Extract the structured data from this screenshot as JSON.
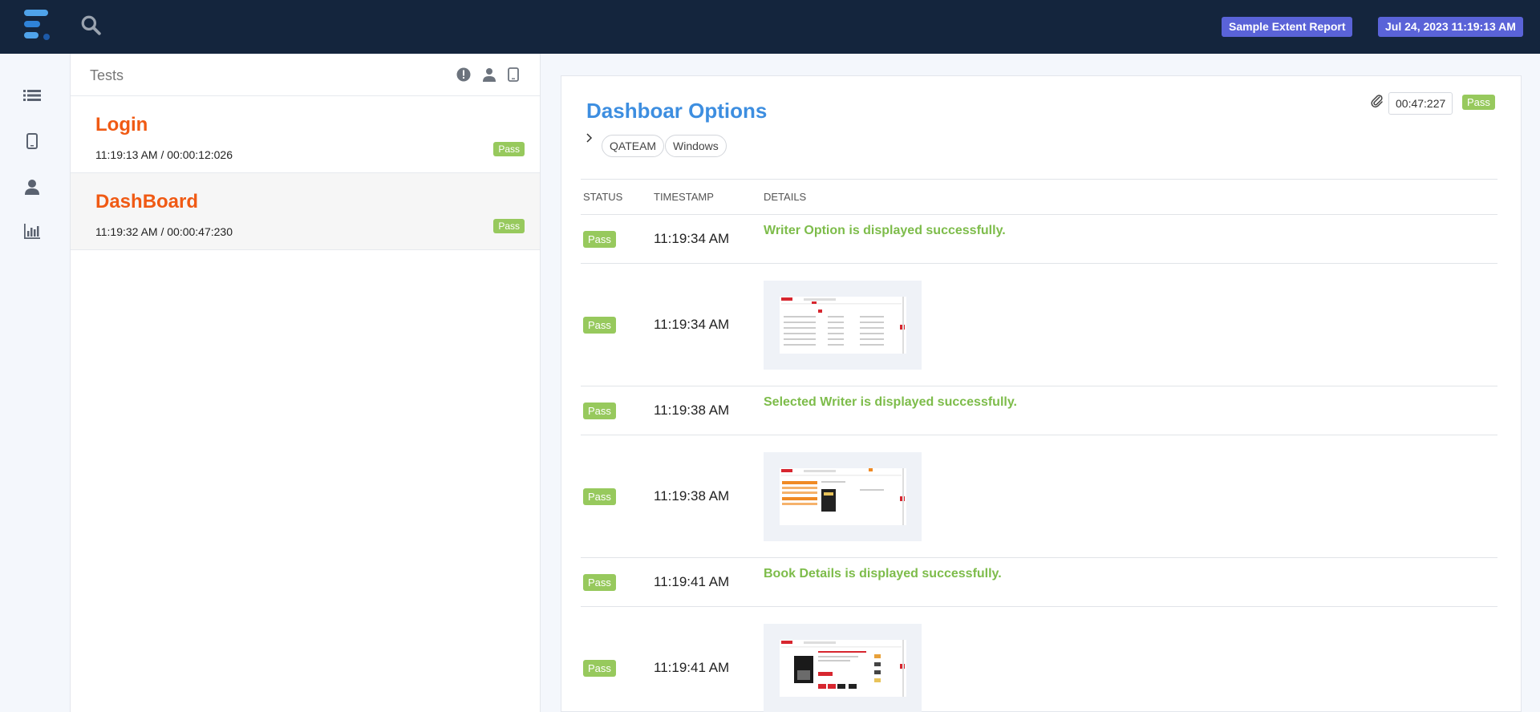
{
  "header": {
    "report_name": "Sample Extent Report",
    "report_datetime": "Jul 24, 2023 11:19:13 AM"
  },
  "nav": {
    "icons": [
      "list-icon",
      "tablet-icon",
      "user-icon",
      "bar-chart-icon"
    ]
  },
  "tests_panel": {
    "title": "Tests",
    "filter_icons": [
      "exclamation-icon",
      "user-icon",
      "tablet-icon"
    ],
    "tests": [
      {
        "name": "Login",
        "meta": "11:19:13 AM / 00:00:12:026",
        "status": "Pass"
      },
      {
        "name": "DashBoard",
        "meta": "11:19:32 AM / 00:00:47:230",
        "status": "Pass"
      }
    ]
  },
  "detail": {
    "title": "Dashboar Options",
    "duration": "00:47:227",
    "status": "Pass",
    "tags": [
      "QATEAM",
      "Windows"
    ],
    "columns": [
      "STATUS",
      "TIMESTAMP",
      "DETAILS"
    ],
    "logs": [
      {
        "status": "Pass",
        "timestamp": "11:19:34 AM",
        "details": "Writer Option is displayed successfully."
      },
      {
        "status": "Pass",
        "timestamp": "11:19:34 AM",
        "screenshot": true
      },
      {
        "status": "Pass",
        "timestamp": "11:19:38 AM",
        "details": "Selected Writer is displayed successfully."
      },
      {
        "status": "Pass",
        "timestamp": "11:19:38 AM",
        "screenshot": true
      },
      {
        "status": "Pass",
        "timestamp": "11:19:41 AM",
        "details": "Book Details is displayed successfully."
      },
      {
        "status": "Pass",
        "timestamp": "11:19:41 AM",
        "screenshot": true
      }
    ]
  },
  "colors": {
    "topbar": "#14253d",
    "badge": "#5a63d8",
    "pass": "#97c95d",
    "test_name": "#f05a14",
    "detail_title": "#3d8ee0",
    "log_message": "#7dbc4a"
  }
}
